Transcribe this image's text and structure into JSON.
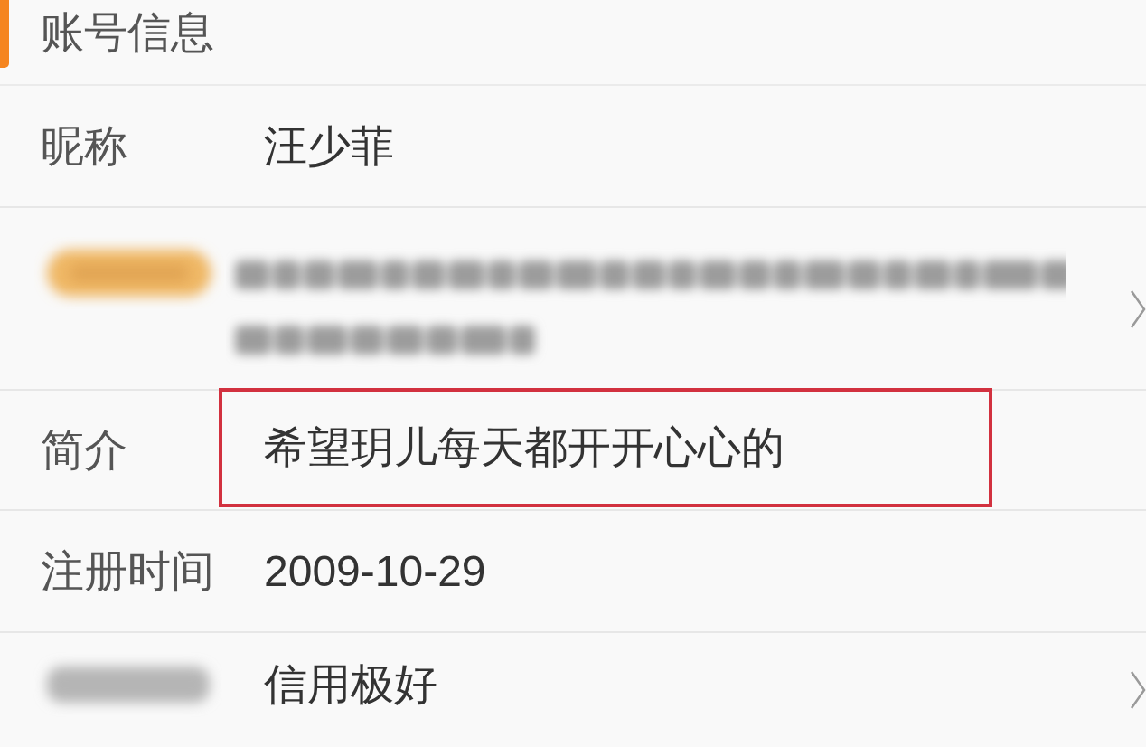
{
  "section": {
    "title": "账号信息"
  },
  "rows": [
    {
      "kind": "plain",
      "label": "昵称",
      "value": "汪少菲",
      "highlighted": false,
      "chevron": false
    },
    {
      "kind": "blurred",
      "highlighted": false,
      "chevron": true
    },
    {
      "kind": "plain",
      "label": "简介",
      "value": "希望玥儿每天都开开心心的",
      "highlighted": true,
      "chevron": false
    },
    {
      "kind": "plain",
      "label": "注册时间",
      "value": "2009-10-29",
      "highlighted": false,
      "chevron": false
    },
    {
      "kind": "blurred_label",
      "value": "信用极好",
      "highlighted": false,
      "chevron": true
    }
  ]
}
